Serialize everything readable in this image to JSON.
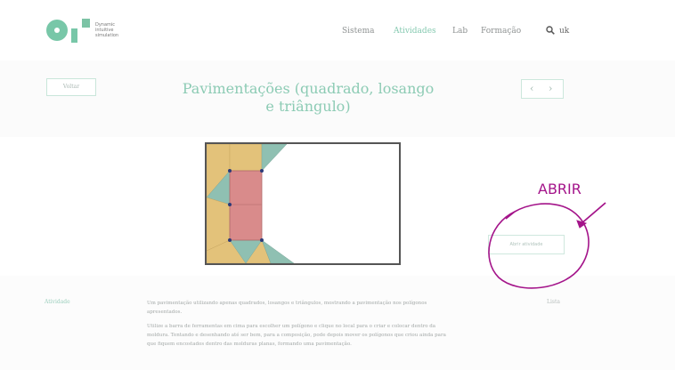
{
  "header": {
    "logo_text": "Dynamic\nintuitive\nsimulation",
    "nav": [
      "Sistema",
      "Atividades",
      "Lab",
      "Formação"
    ],
    "active_index": 1,
    "search_icon": "search-icon",
    "lang": "uk"
  },
  "page": {
    "back_label": "Voltar",
    "title": "Pavimentações (quadrado, losango e triângulo)",
    "prev_symbol": "‹",
    "next_symbol": "›"
  },
  "activity": {
    "open_button_label": "Abrir atividade"
  },
  "annotation": {
    "handwritten": "ABRIR",
    "color": "#a4148a"
  },
  "content": {
    "side_label": "Atividade",
    "side_right": "Lista",
    "paragraphs": [
      "Um pavimentação utilizando apenas quadrados, losangos e triângulos, mostrando a pavimentação nos polígonos apresentados.",
      "Utilize a barra de ferramentas em cima para escolher um polígono e clique no local para o criar e colocar dentro da moldura. Tentando e desenhando até ser bem, para a composição, pode depois mover os polígonos que criou ainda para que fiquem encostados dentro das molduras planas, formando uma pavimentação."
    ]
  },
  "colors": {
    "accent": "#85c9b0",
    "tan": "#e3c27a",
    "teal": "#8fc0b2",
    "rose": "#d98b8b",
    "vertex": "#2c3a78"
  }
}
